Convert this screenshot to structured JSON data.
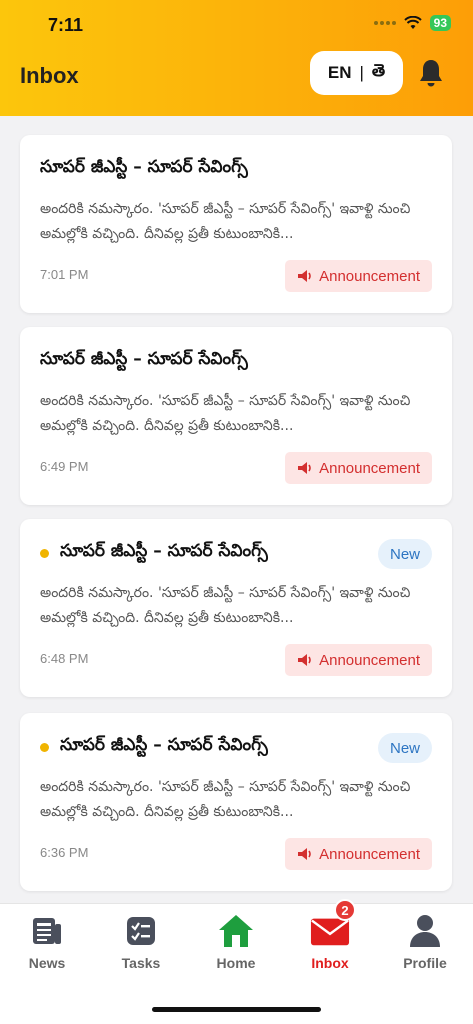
{
  "status_bar": {
    "time": "7:11",
    "battery": "93"
  },
  "header": {
    "title": "Inbox",
    "lang_en": "EN",
    "lang_te": "తె"
  },
  "messages": [
    {
      "title": "సూపర్ జీఎస్టీ – సూపర్ సేవింగ్స్",
      "body": "అందరికి నమస్కారం. 'సూపర్ జీఎస్టీ – సూపర్ సేవింగ్స్' ఇవాళ్టి నుంచి అమల్లోకి వచ్చింది. దీనివల్ల ప్రతీ కుటుంబానికి...",
      "time": "7:01 PM",
      "tag": "Announcement",
      "unread": false
    },
    {
      "title": "సూపర్ జీఎస్టీ – సూపర్ సేవింగ్స్",
      "body": "అందరికి నమస్కారం. 'సూపర్ జీఎస్టీ – సూపర్ సేవింగ్స్' ఇవాళ్టి నుంచి అమల్లోకి వచ్చింది. దీనివల్ల ప్రతీ కుటుంబానికి...",
      "time": "6:49 PM",
      "tag": "Announcement",
      "unread": false
    },
    {
      "title": "సూపర్ జీఎస్టీ – సూపర్ సేవింగ్స్",
      "body": "అందరికి నమస్కారం. 'సూపర్ జీఎస్టీ – సూపర్ సేవింగ్స్' ఇవాళ్టి నుంచి అమల్లోకి వచ్చింది. దీనివల్ల ప్రతీ కుటుంబానికి...",
      "time": "6:48 PM",
      "tag": "Announcement",
      "unread": true,
      "badge": "New"
    },
    {
      "title": "సూపర్ జీఎస్టీ – సూపర్ సేవింగ్స్",
      "body": "అందరికి నమస్కారం. 'సూపర్ జీఎస్టీ – సూపర్ సేవింగ్స్' ఇవాళ్టి నుంచి అమల్లోకి వచ్చింది. దీనివల్ల ప్రతీ కుటుంబానికి...",
      "time": "6:36 PM",
      "tag": "Announcement",
      "unread": true,
      "badge": "New"
    }
  ],
  "tabbar": {
    "tabs": [
      {
        "label": "News",
        "icon": "newspaper-icon"
      },
      {
        "label": "Tasks",
        "icon": "tasks-icon"
      },
      {
        "label": "Home",
        "icon": "home-icon"
      },
      {
        "label": "Inbox",
        "icon": "mail-icon",
        "badge": "2"
      },
      {
        "label": "Profile",
        "icon": "profile-icon"
      }
    ],
    "active": "Inbox"
  },
  "colors": {
    "accent": "#fcb10a",
    "tag_text": "#d32f2f",
    "tag_bg": "#fde5e4",
    "new_badge": "#2d75c2",
    "home_green": "#1e9e3e",
    "inbox_red": "#e01e1e"
  }
}
